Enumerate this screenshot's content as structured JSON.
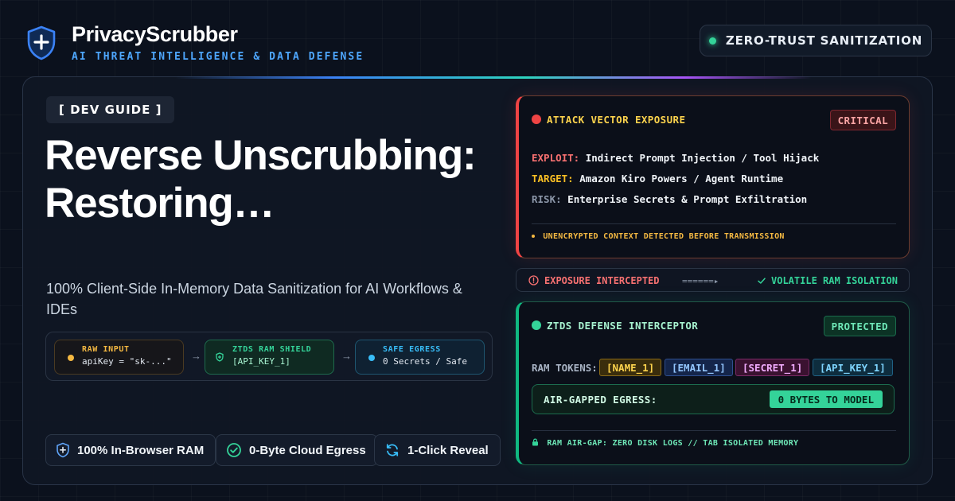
{
  "brand": {
    "name": "PrivacyScrubber",
    "tagline": "AI THREAT INTELLIGENCE & DATA DEFENSE",
    "logo_icon": "shield-plus-icon"
  },
  "badge": {
    "label": "ZERO-TRUST SANITIZATION",
    "status_color": "#34d399"
  },
  "hero": {
    "tag": "[ DEV GUIDE ]",
    "title": "Reverse Unscrubbing: Restoring…",
    "subtitle": "100% Client-Side In-Memory Data Sanitization for AI Workflows & IDEs"
  },
  "flow": {
    "steps": [
      {
        "title": "RAW INPUT",
        "value": "apiKey = \"sk-...\"",
        "color": "#f5b942",
        "icon": "dot-icon"
      },
      {
        "title": "ZTDS RAM SHIELD",
        "value": "[API_KEY_1]",
        "color": "#34d399",
        "icon": "shield-icon"
      },
      {
        "title": "SAFE EGRESS",
        "value": "0 Secrets / Safe",
        "color": "#38bdf8",
        "icon": "dot-icon"
      }
    ],
    "arrow": "→"
  },
  "features": [
    {
      "label": "100% In-Browser RAM",
      "icon": "shield-plus-icon"
    },
    {
      "label": "0-Byte Cloud Egress",
      "icon": "check-circle-icon"
    },
    {
      "label": "1-Click Reveal",
      "icon": "refresh-icon"
    }
  ],
  "attack_panel": {
    "title": "ATTACK VECTOR EXPOSURE",
    "status": "CRITICAL",
    "accent": "#ef4444",
    "rows": [
      {
        "key": "EXPLOIT:",
        "value": "Indirect Prompt Injection / Tool Hijack"
      },
      {
        "key": "TARGET:",
        "value": "Amazon Kiro Powers / Agent Runtime"
      },
      {
        "key": "RISK:",
        "value": "Enterprise Secrets & Prompt Exfiltration"
      }
    ],
    "footer": "UNENCRYPTED CONTEXT DETECTED BEFORE TRANSMISSION"
  },
  "intercept_bar": {
    "left": "EXPOSURE INTERCEPTED",
    "arrow": "======▸",
    "right": "VOLATILE RAM ISOLATION"
  },
  "defense_panel": {
    "title": "ZTDS DEFENSE INTERCEPTOR",
    "status": "PROTECTED",
    "accent": "#10b981",
    "tokens_label": "RAM TOKENS:",
    "tokens": [
      "[NAME_1]",
      "[EMAIL_1]",
      "[SECRET_1]",
      "[API_KEY_1]"
    ],
    "egress_label": "AIR-GAPPED EGRESS:",
    "egress_value": "0 BYTES TO MODEL",
    "footer": "RAM AIR-GAP: ZERO DISK LOGS // TAB ISOLATED MEMORY"
  }
}
